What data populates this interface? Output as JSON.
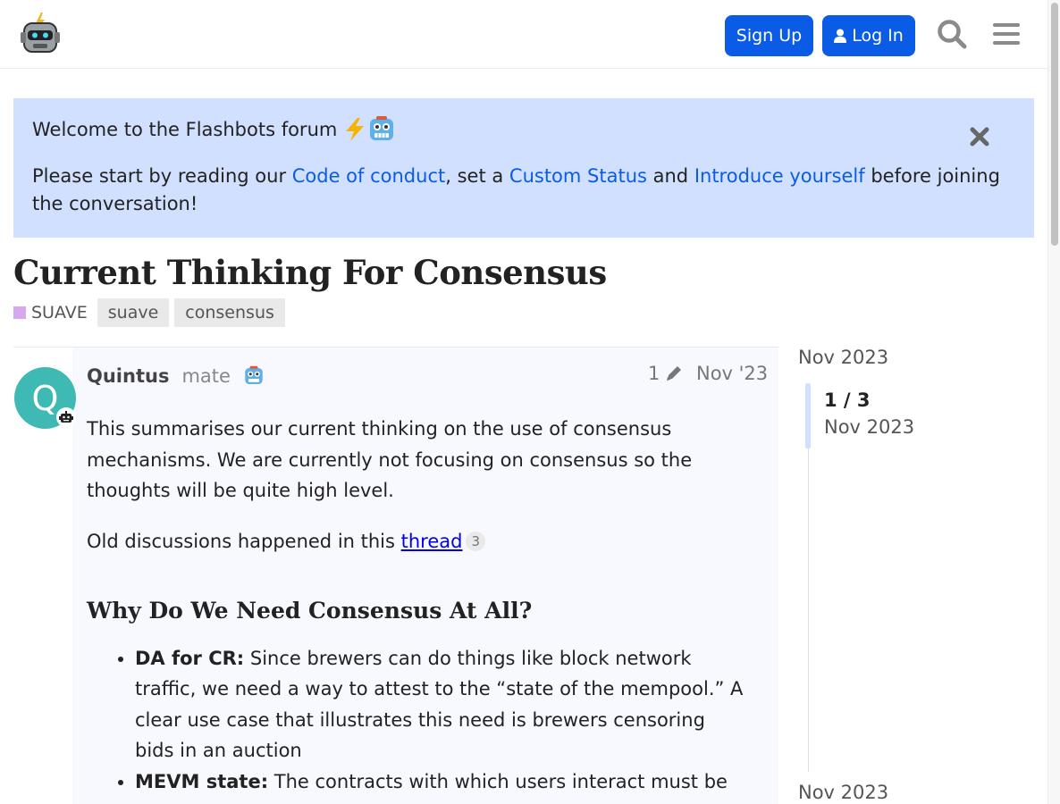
{
  "header": {
    "logo": "flashbots-robot-logo",
    "signup_label": "Sign Up",
    "login_label": "Log In",
    "search_icon": "search-icon",
    "menu_icon": "hamburger-menu-icon",
    "accent_color": "#0a5ce6"
  },
  "banner": {
    "title": "Welcome to the Flashbots forum",
    "line_prefix": "Please start by reading our ",
    "link_code_of_conduct": "Code of conduct",
    "sep1": ", set a ",
    "link_custom_status": "Custom Status",
    "sep2": " and ",
    "link_introduce": "Introduce yourself",
    "line_suffix": " before joining the conversation!",
    "background": "#d1e0ff"
  },
  "topic": {
    "title": "Current Thinking For Consensus",
    "category": "SUAVE",
    "category_color": "#d5a8f0",
    "tags": [
      "suave",
      "consensus"
    ]
  },
  "post": {
    "avatar_letter": "Q",
    "avatar_color": "#3fb9b3",
    "username": "Quintus",
    "user_title": "mate",
    "edit_count": "1",
    "date": "Nov '23",
    "para1": "This summarises our current thinking on the use of consensus mechanisms. We are currently not focusing on consensus so the thoughts will be quite high level.",
    "para2_prefix": "Old discussions happened in this ",
    "para2_link": "thread",
    "para2_link_count": "3",
    "heading": "Why Do We Need Consensus At All?",
    "list": [
      {
        "bold": "DA for CR:",
        "text": " Since brewers can do things like block network traffic, we need a way to attest to the “state of the mempool.” A clear use case that illustrates this need is brewers censoring bids in an auction"
      },
      {
        "bold": "MEVM state:",
        "text": " The contracts with which users interact must be"
      }
    ]
  },
  "timeline": {
    "date_top": "Nov 2023",
    "position": "1 / 3",
    "position_date": "Nov 2023",
    "date_bottom": "Nov 2023"
  }
}
